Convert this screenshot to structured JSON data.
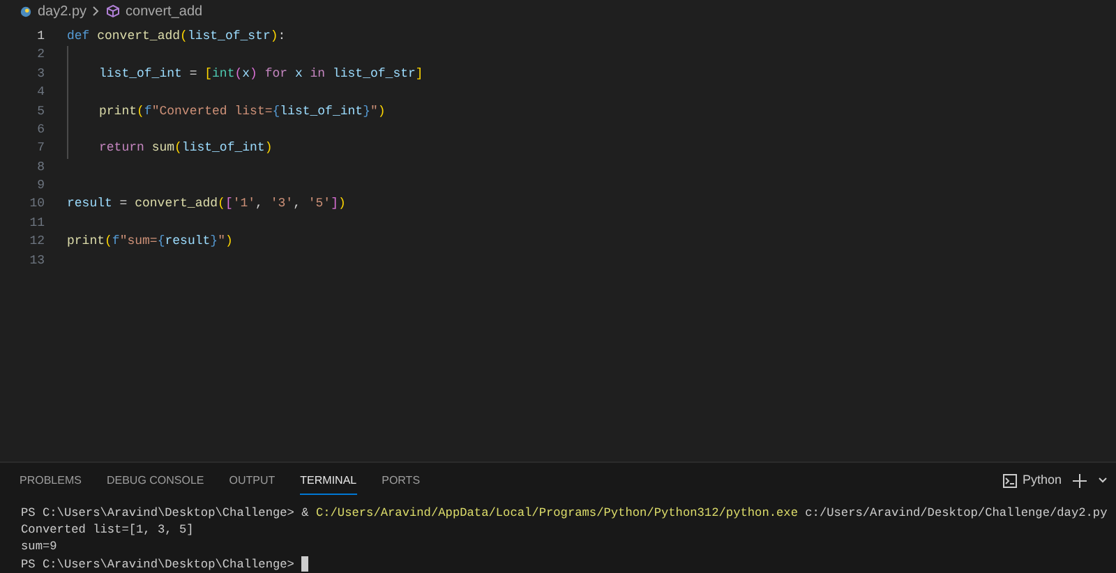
{
  "breadcrumb": {
    "file": "day2.py",
    "symbol": "convert_add"
  },
  "editor": {
    "lines": [
      {
        "number": "1",
        "active": true,
        "tokens": [
          {
            "kind": "keyword",
            "text": "def "
          },
          {
            "kind": "function",
            "text": "convert_add"
          },
          {
            "kind": "bracket1",
            "text": "("
          },
          {
            "kind": "variable",
            "text": "list_of_str"
          },
          {
            "kind": "bracket1",
            "text": ")"
          },
          {
            "kind": "plain",
            "text": ":"
          }
        ],
        "children": [
          {
            "number": "2",
            "active": false
          },
          {
            "number": "3",
            "active": false,
            "tokens": [
              {
                "kind": "variable",
                "text": "list_of_int"
              },
              {
                "kind": "plain",
                "text": " = "
              },
              {
                "kind": "bracket1",
                "text": "["
              },
              {
                "kind": "type",
                "text": "int"
              },
              {
                "kind": "bracket2",
                "text": "("
              },
              {
                "kind": "variable",
                "text": "x"
              },
              {
                "kind": "bracket2",
                "text": ")"
              },
              {
                "kind": "control",
                "text": " for "
              },
              {
                "kind": "variable",
                "text": "x"
              },
              {
                "kind": "control",
                "text": " in "
              },
              {
                "kind": "variable",
                "text": "list_of_str"
              },
              {
                "kind": "bracket1",
                "text": "]"
              }
            ]
          },
          {
            "number": "4",
            "active": false
          },
          {
            "number": "5",
            "active": false,
            "tokens": [
              {
                "kind": "function",
                "text": "print"
              },
              {
                "kind": "bracket1",
                "text": "("
              },
              {
                "kind": "keyword",
                "text": "f"
              },
              {
                "kind": "string",
                "text": "\"Converted list="
              },
              {
                "kind": "keyword",
                "text": "{"
              },
              {
                "kind": "variable",
                "text": "list_of_int"
              },
              {
                "kind": "keyword",
                "text": "}"
              },
              {
                "kind": "string",
                "text": "\""
              },
              {
                "kind": "bracket1",
                "text": ")"
              }
            ]
          },
          {
            "number": "6",
            "active": false
          },
          {
            "number": "7",
            "active": false,
            "tokens": [
              {
                "kind": "control",
                "text": "return "
              },
              {
                "kind": "function",
                "text": "sum"
              },
              {
                "kind": "bracket1",
                "text": "("
              },
              {
                "kind": "variable",
                "text": "list_of_int"
              },
              {
                "kind": "bracket1",
                "text": ")"
              }
            ]
          }
        ]
      },
      {
        "number": "8",
        "active": false
      },
      {
        "number": "9",
        "active": false
      },
      {
        "number": "10",
        "active": false,
        "tokens": [
          {
            "kind": "variable",
            "text": "result"
          },
          {
            "kind": "plain",
            "text": " = "
          },
          {
            "kind": "function",
            "text": "convert_add"
          },
          {
            "kind": "bracket1",
            "text": "("
          },
          {
            "kind": "bracket2",
            "text": "["
          },
          {
            "kind": "string",
            "text": "'1'"
          },
          {
            "kind": "plain",
            "text": ", "
          },
          {
            "kind": "string",
            "text": "'3'"
          },
          {
            "kind": "plain",
            "text": ", "
          },
          {
            "kind": "string",
            "text": "'5'"
          },
          {
            "kind": "bracket2",
            "text": "]"
          },
          {
            "kind": "bracket1",
            "text": ")"
          }
        ]
      },
      {
        "number": "11",
        "active": false
      },
      {
        "number": "12",
        "active": false,
        "tokens": [
          {
            "kind": "function",
            "text": "print"
          },
          {
            "kind": "bracket1",
            "text": "("
          },
          {
            "kind": "keyword",
            "text": "f"
          },
          {
            "kind": "string",
            "text": "\"sum="
          },
          {
            "kind": "keyword",
            "text": "{"
          },
          {
            "kind": "variable",
            "text": "result"
          },
          {
            "kind": "keyword",
            "text": "}"
          },
          {
            "kind": "string",
            "text": "\""
          },
          {
            "kind": "bracket1",
            "text": ")"
          }
        ]
      },
      {
        "number": "13",
        "active": false
      }
    ]
  },
  "panel": {
    "tabs": [
      {
        "label": "PROBLEMS",
        "selected": false
      },
      {
        "label": "DEBUG CONSOLE",
        "selected": false
      },
      {
        "label": "OUTPUT",
        "selected": false
      },
      {
        "label": "TERMINAL",
        "selected": true
      },
      {
        "label": "PORTS",
        "selected": false
      }
    ],
    "terminal_label": "Python",
    "terminal": {
      "lines": [
        {
          "segments": [
            {
              "kind": "plain",
              "text": "PS C:\\Users\\Aravind\\Desktop\\Challenge> & "
            },
            {
              "kind": "command",
              "text": "C:/Users/Aravind/AppData/Local/Programs/Python/Python312/python.exe"
            },
            {
              "kind": "plain",
              "text": " c:/Users/Aravind/Desktop/Challenge/day2.py"
            }
          ]
        },
        {
          "segments": [
            {
              "kind": "plain",
              "text": "Converted list=[1, 3, 5]"
            }
          ]
        },
        {
          "segments": [
            {
              "kind": "plain",
              "text": "sum=9"
            }
          ]
        },
        {
          "segments": [
            {
              "kind": "plain",
              "text": "PS C:\\Users\\Aravind\\Desktop\\Challenge> "
            }
          ],
          "cursor": true
        }
      ]
    }
  }
}
